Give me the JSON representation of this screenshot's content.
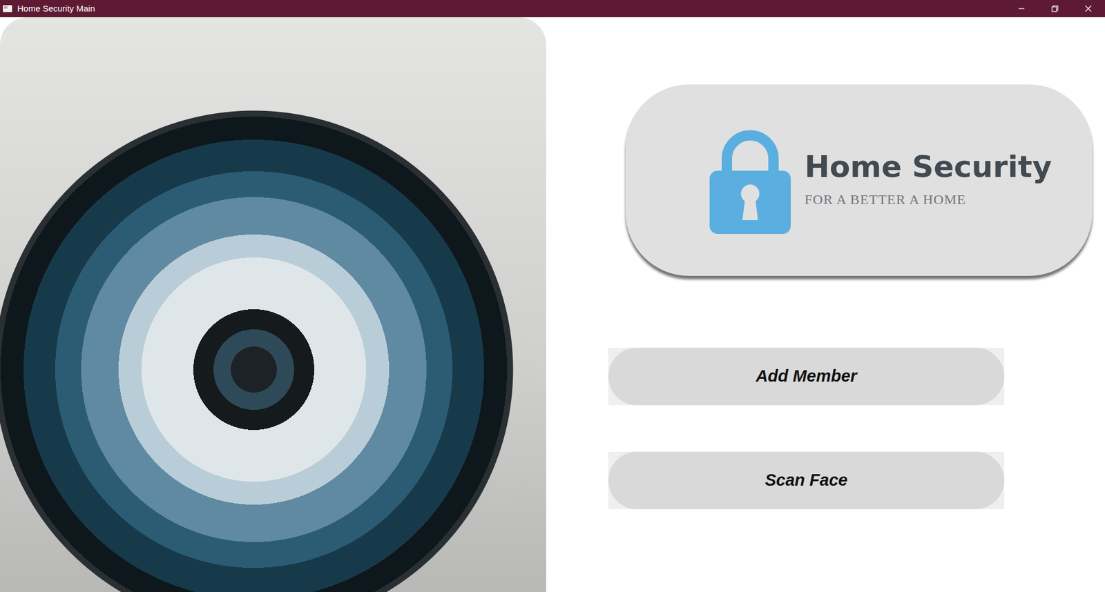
{
  "window": {
    "title": "Home Security Main"
  },
  "logo": {
    "title": "Home Security",
    "tagline": "FOR A BETTER A HOME"
  },
  "buttons": [
    "Add Member",
    "Scan Face"
  ]
}
